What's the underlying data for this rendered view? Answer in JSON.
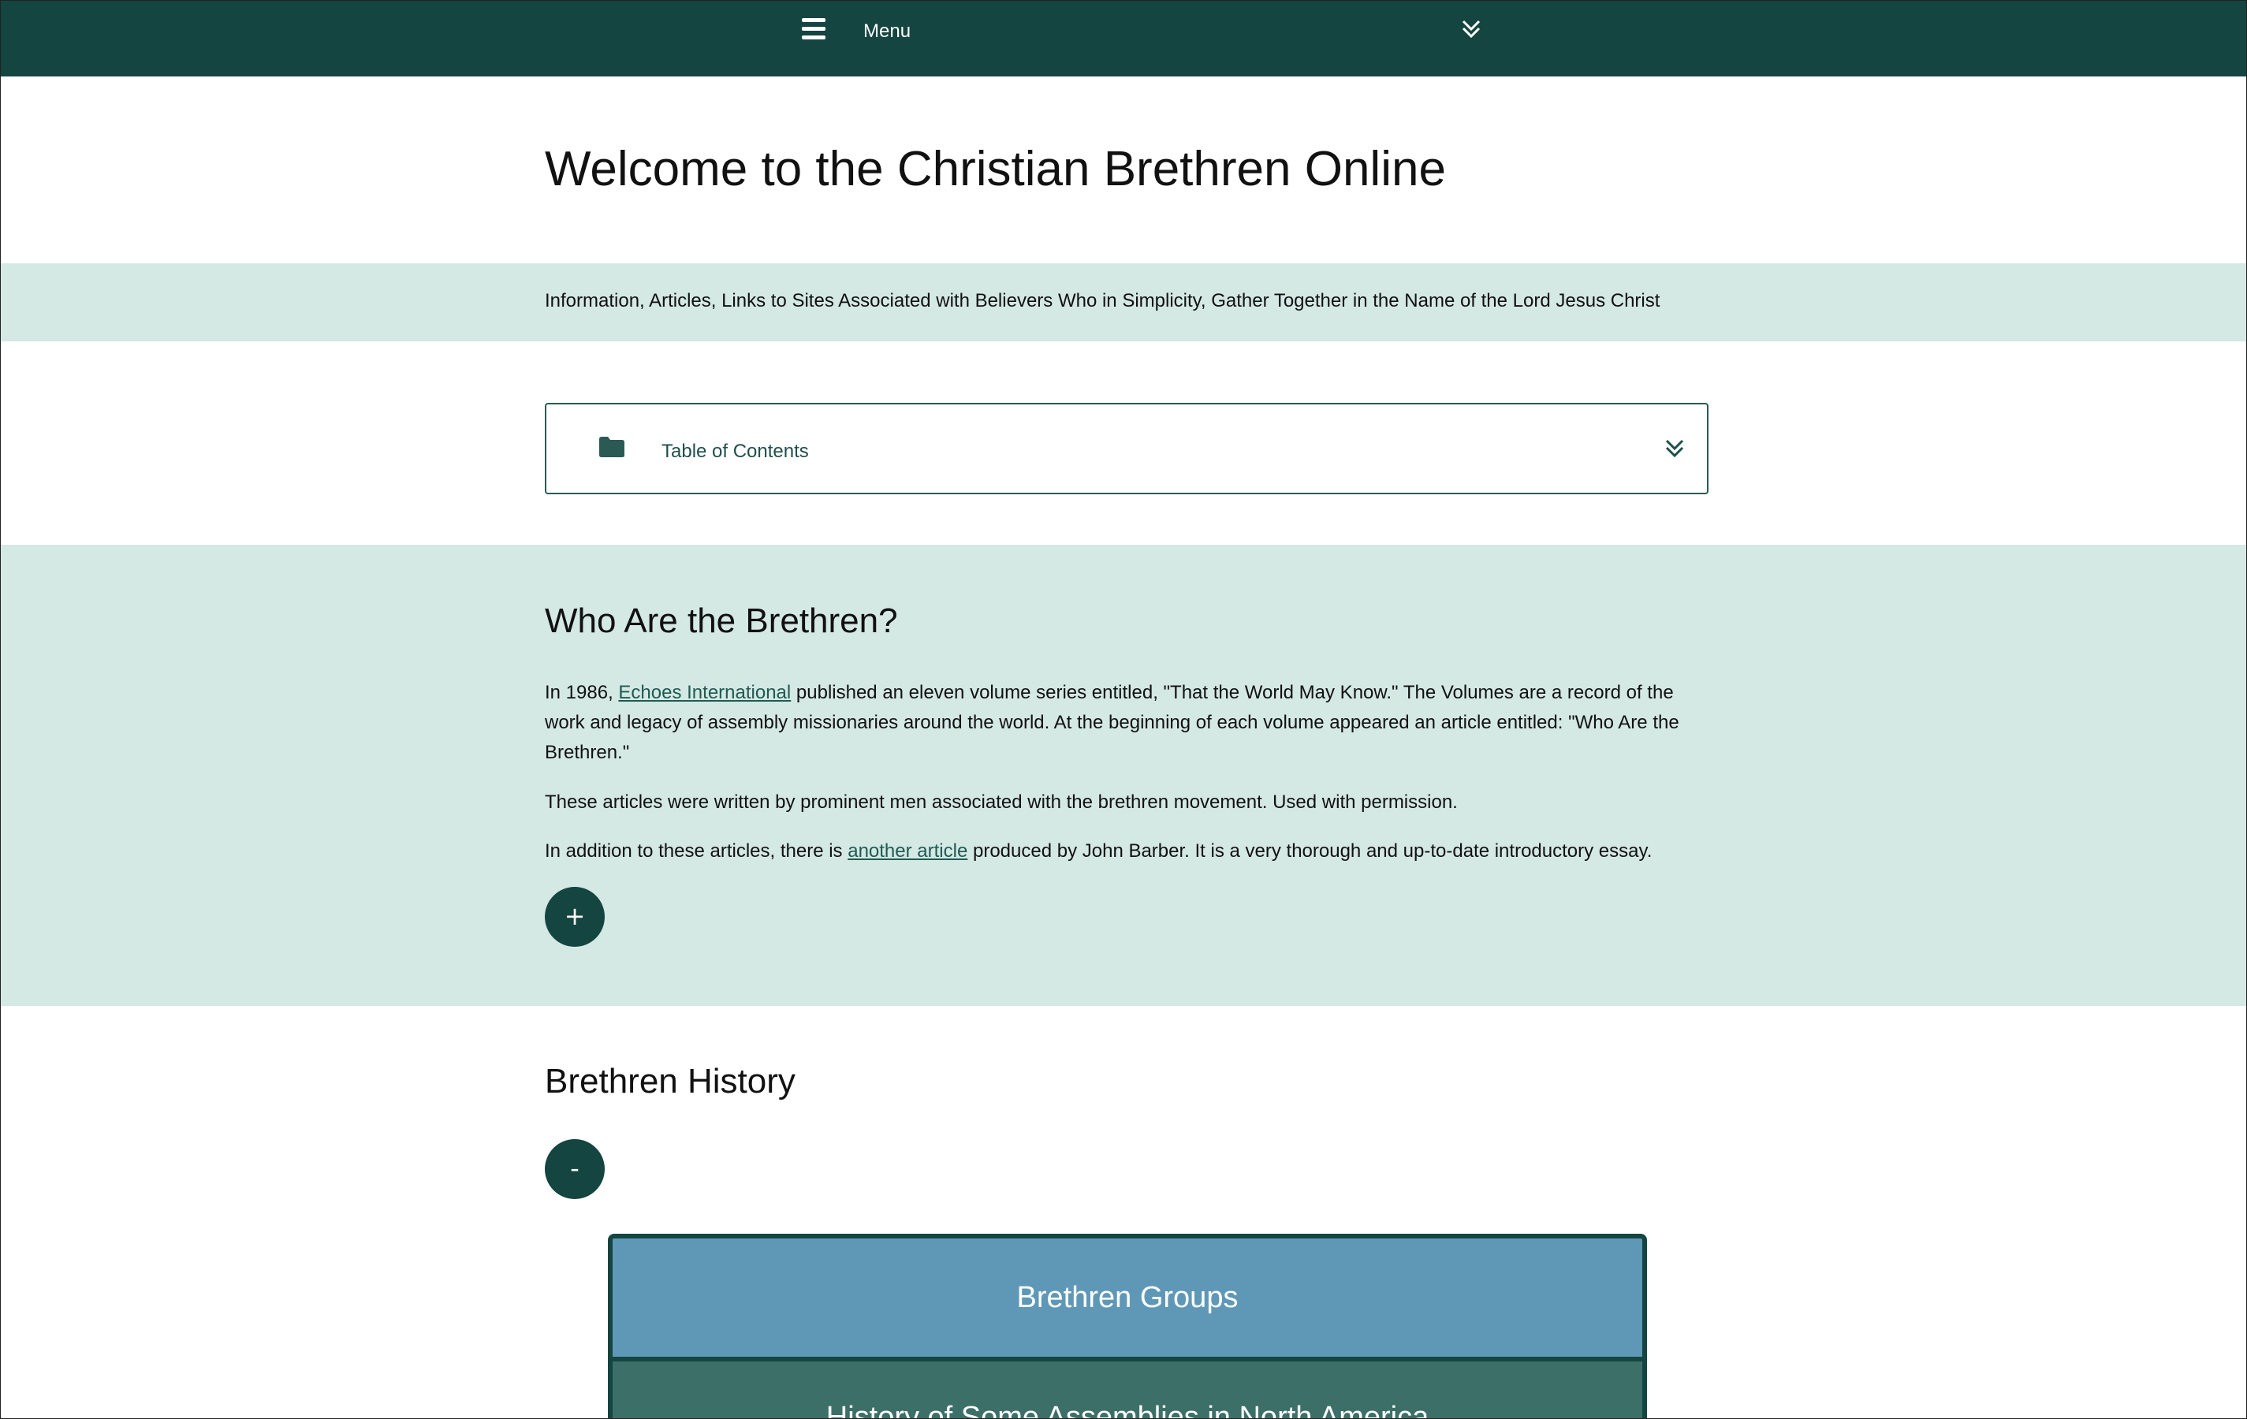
{
  "topbar": {
    "menu_label": "Menu",
    "hamburger_icon": "hamburger-icon",
    "chevron_icon": "double-chevron-down-icon",
    "background": "#154540"
  },
  "header": {
    "title": "Welcome to the Christian Brethren Online",
    "subtitle": "Information, Articles, Links to Sites Associated with Believers Who in Simplicity, Gather Together in the Name of the Lord Jesus Christ"
  },
  "toc": {
    "label": "Table of Contents",
    "folder_icon": "folder-icon",
    "chevron_icon": "double-chevron-down-icon"
  },
  "who_section": {
    "heading": "Who Are the Brethren?",
    "p1_before": "In 1986, ",
    "p1_link": "Echoes International",
    "p1_after": " published an eleven volume series entitled, \"That the World May Know.\" The Volumes are a record of the work and legacy of assembly missionaries around the world. At the beginning of each volume appeared an article entitled: \"Who Are the Brethren.\"",
    "p2": "These articles were written by prominent men associated with the brethren movement. Used with permission.",
    "p3_before": "In addition to these articles, there is ",
    "p3_link": "another article",
    "p3_after": " produced by John Barber. It is a very thorough and up-to-date introductory essay.",
    "toggle_label": "+"
  },
  "history_section": {
    "heading": "Brethren History",
    "toggle_label": "-",
    "items": [
      {
        "label": "Brethren Groups"
      },
      {
        "label": "History of Some Assemblies in North America"
      }
    ]
  },
  "colors": {
    "dark_green": "#154540",
    "band_light": "#d4e8e4",
    "link": "#1f5a52",
    "blue_tile": "#5f98b7",
    "teal_tile": "#3d6f69"
  }
}
